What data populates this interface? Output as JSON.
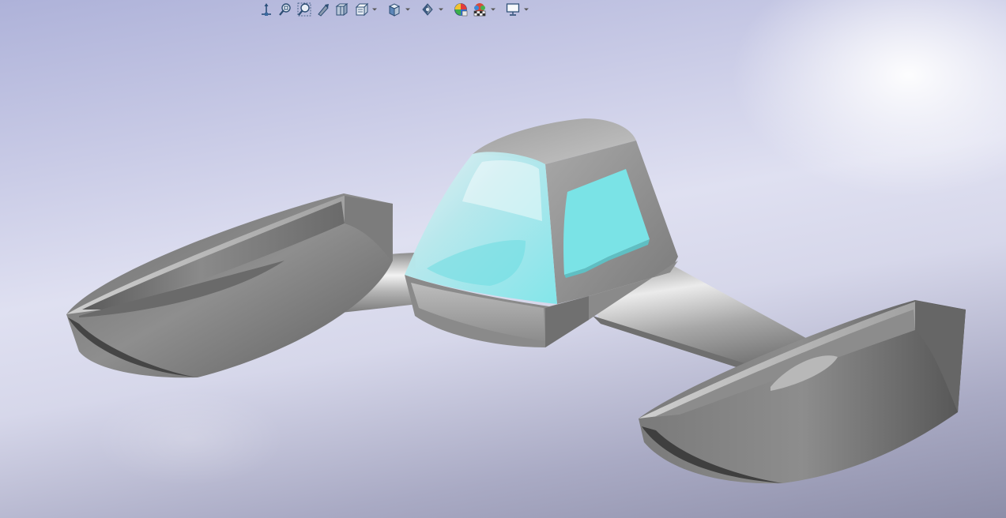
{
  "window": {
    "type": "3d-cad-graphics-area",
    "background_colors": [
      "#aeb2d9",
      "#dfe0f1",
      "#8d8ea8"
    ]
  },
  "heads_up_toolbar": {
    "tools": [
      {
        "name": "view-orientation-triad",
        "icon": "axis-arrows-icon"
      },
      {
        "name": "zoom-to-fit",
        "icon": "zoom-to-fit-icon"
      },
      {
        "name": "zoom-to-area",
        "icon": "zoom-area-icon"
      },
      {
        "name": "previous-view",
        "icon": "previous-view-icon"
      },
      {
        "name": "section-view",
        "icon": "section-view-icon"
      },
      {
        "name": "dynamic-annotation-views",
        "icon": "annotation-views-icon",
        "has_menu": true
      },
      {
        "name": "view-orientation",
        "icon": "view-cube-icon",
        "has_menu": true
      },
      {
        "name": "display-style",
        "icon": "display-style-icon",
        "has_menu": true
      },
      {
        "name": "hide-show-items",
        "icon": "eye-icon",
        "has_menu": true
      },
      {
        "name": "edit-appearance",
        "icon": "appearance-icon"
      },
      {
        "name": "apply-scene",
        "icon": "scene-icon",
        "has_menu": true
      },
      {
        "name": "view-settings",
        "icon": "monitor-icon",
        "has_menu": true
      }
    ]
  },
  "model": {
    "description_colors": {
      "body": "#9b9b9b",
      "glass": "#7fe6ea",
      "window": "#7ae3e6"
    }
  }
}
